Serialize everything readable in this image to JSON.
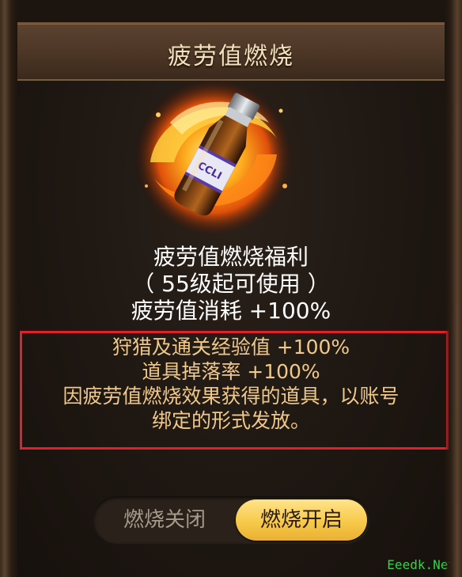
{
  "title": "疲劳值燃烧",
  "item": {
    "icon": "energy-drink-bottle-icon",
    "label_text": "CCLI"
  },
  "description": {
    "line1": "疲劳值燃烧福利",
    "line2": "（ 55级起可使用 ）",
    "line3": "疲劳值消耗 +100%"
  },
  "bonuses": [
    "狩猎及通关经验值 +100%",
    "道具掉落率 +100%",
    "因疲劳值燃烧效果获得的道具，以账号",
    "绑定的形式发放。"
  ],
  "toggle": {
    "off_label": "燃烧关闭",
    "on_label": "燃烧开启",
    "selected": "on"
  },
  "watermark": "Eeedk.Net",
  "colors": {
    "highlight_border": "#e0202a",
    "bonus_text": "#f0c98a",
    "active_button": "#f7c94a"
  }
}
